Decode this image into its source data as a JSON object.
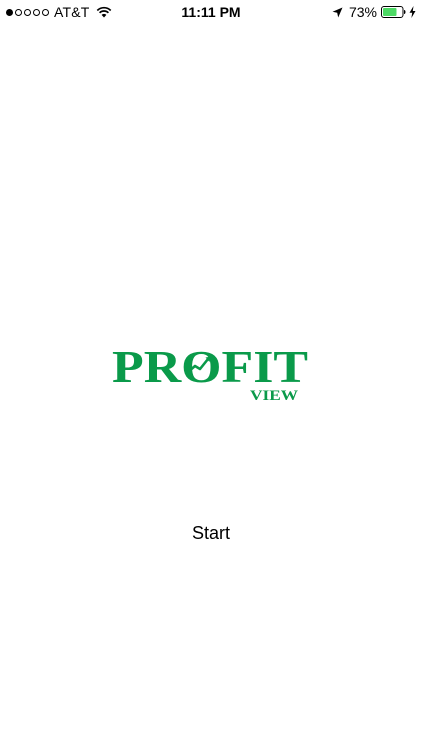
{
  "status_bar": {
    "signal_dots_filled": 1,
    "signal_dots_total": 5,
    "carrier": "AT&T",
    "time": "11:11 PM",
    "battery_percent": "73%",
    "battery_level": 0.73,
    "icons": [
      "wifi-icon",
      "location-arrow-icon",
      "battery-icon",
      "charging-bolt-icon"
    ]
  },
  "logo": {
    "brand_main": "PROFIT",
    "brand_sub": "VIEW",
    "color": "#0a9a4a"
  },
  "main": {
    "start_label": "Start"
  }
}
